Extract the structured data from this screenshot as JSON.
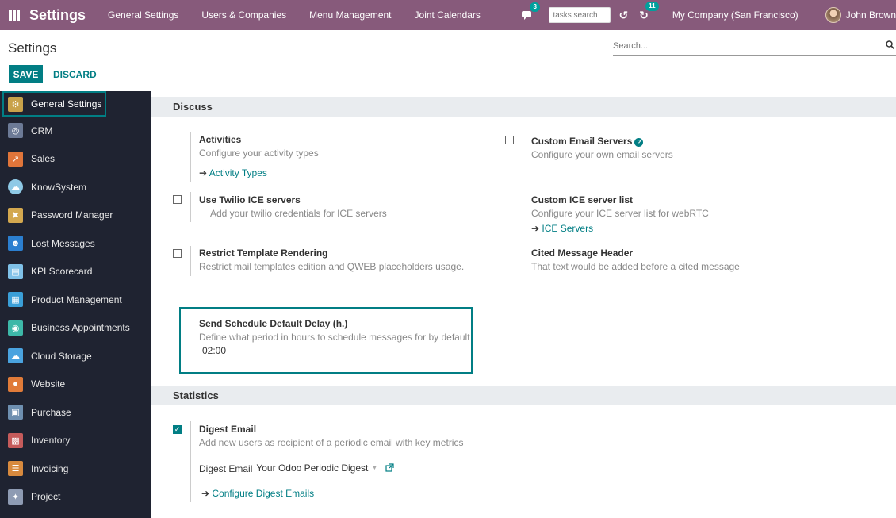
{
  "topbar": {
    "app_title": "Settings",
    "menu": [
      "General Settings",
      "Users & Companies",
      "Menu Management",
      "Joint Calendars"
    ],
    "chat_badge": "3",
    "tasks_search_placeholder": "tasks search",
    "activity_badge": "11",
    "company": "My Company (San Francisco)",
    "user": "John Brown"
  },
  "control_panel": {
    "title": "Settings",
    "search_placeholder": "Search...",
    "save_label": "SAVE",
    "discard_label": "DISCARD"
  },
  "sidebar": {
    "items": [
      {
        "label": "General Settings",
        "icon": "gear-icon",
        "color": "#c9a24a"
      },
      {
        "label": "CRM",
        "icon": "crm-icon",
        "color": "#6c7a96"
      },
      {
        "label": "Sales",
        "icon": "sales-chart-icon",
        "color": "#e0753a"
      },
      {
        "label": "KnowSystem",
        "icon": "brain-icon",
        "color": "#8ec9e6"
      },
      {
        "label": "Password Manager",
        "icon": "password-keys-icon",
        "color": "#d3a84f"
      },
      {
        "label": "Lost Messages",
        "icon": "person-icon",
        "color": "#2b7fd0"
      },
      {
        "label": "KPI Scorecard",
        "icon": "scorecard-icon",
        "color": "#7fc1e8"
      },
      {
        "label": "Product Management",
        "icon": "product-building-icon",
        "color": "#3a9fd8"
      },
      {
        "label": "Business Appointments",
        "icon": "appointment-icon",
        "color": "#3db8a8"
      },
      {
        "label": "Cloud Storage",
        "icon": "cloud-icon",
        "color": "#4aa3df"
      },
      {
        "label": "Website",
        "icon": "globe-icon",
        "color": "#e07b39"
      },
      {
        "label": "Purchase",
        "icon": "purchase-card-icon",
        "color": "#6e8fb0"
      },
      {
        "label": "Inventory",
        "icon": "inventory-box-icon",
        "color": "#c55b5b"
      },
      {
        "label": "Invoicing",
        "icon": "invoice-icon",
        "color": "#d88a3e"
      },
      {
        "label": "Project",
        "icon": "project-puzzle-icon",
        "color": "#8e9bb3"
      }
    ]
  },
  "discuss": {
    "header": "Discuss",
    "activities": {
      "title": "Activities",
      "desc": "Configure your activity types",
      "link": "Activity Types"
    },
    "custom_email": {
      "title": "Custom Email Servers",
      "desc": "Configure your own email servers",
      "help": "?"
    },
    "twilio": {
      "title": "Use Twilio ICE servers",
      "desc": "Add your twilio credentials for ICE servers"
    },
    "ice_list": {
      "title": "Custom ICE server list",
      "desc": "Configure your ICE server list for webRTC",
      "link": "ICE Servers"
    },
    "restrict": {
      "title": "Restrict Template Rendering",
      "desc": "Restrict mail templates edition and QWEB placeholders usage."
    },
    "cited": {
      "title": "Cited Message Header",
      "desc": "That text would be added before a cited message"
    },
    "delay": {
      "title": "Send Schedule Default Delay (h.)",
      "desc": "Define what period in hours to schedule messages for by default",
      "value": "02:00"
    }
  },
  "statistics": {
    "header": "Statistics",
    "digest": {
      "title": "Digest Email",
      "desc": "Add new users as recipient of a periodic email with key metrics",
      "field_label": "Digest Email",
      "field_value": "Your Odoo Periodic Digest",
      "link": "Configure Digest Emails",
      "checked": true
    }
  },
  "colors": {
    "brand": "#875a7b",
    "accent": "#017e84",
    "sidebar_bg": "#1f2331"
  }
}
